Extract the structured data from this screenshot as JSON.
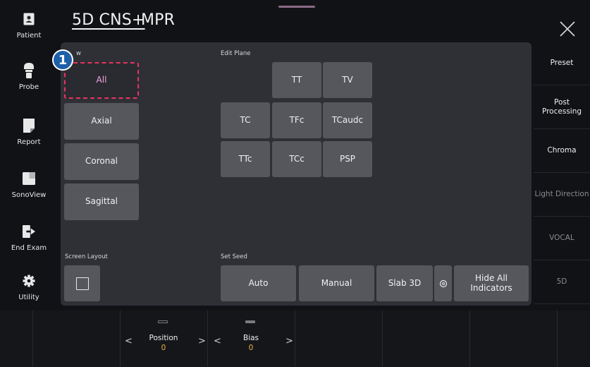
{
  "header": {
    "tabs": [
      {
        "label": "5D CNS+"
      },
      {
        "label": "MPR"
      }
    ]
  },
  "left_nav": [
    {
      "label": "Patient",
      "icon": "patient-icon"
    },
    {
      "label": "Probe",
      "icon": "probe-icon"
    },
    {
      "label": "Report",
      "icon": "report-icon"
    },
    {
      "label": "SonoView",
      "icon": "sonoview-icon"
    },
    {
      "label": "End Exam",
      "icon": "end-exam-icon"
    },
    {
      "label": "Utility",
      "icon": "gear-icon"
    }
  ],
  "panel": {
    "view_label": "w",
    "view_buttons": [
      "All",
      "Axial",
      "Coronal",
      "Sagittal"
    ],
    "edit_plane_label": "Edit Plane",
    "edit_plane_buttons": [
      "TT",
      "TV",
      "TC",
      "TFc",
      "TCaudc",
      "TTc",
      "TCc",
      "PSP"
    ],
    "screen_layout_label": "Screen Layout",
    "set_seed_label": "Set Seed",
    "seed_buttons": [
      "Auto",
      "Manual",
      "Slab 3D",
      "Hide All Indicators"
    ]
  },
  "badge": "1",
  "right_nav": [
    {
      "label": "Preset",
      "enabled": true
    },
    {
      "label": "Post Processing",
      "enabled": true
    },
    {
      "label": "Chroma",
      "enabled": true
    },
    {
      "label": "Light Direction",
      "enabled": false
    },
    {
      "label": "VOCAL",
      "enabled": false
    },
    {
      "label": "5D",
      "enabled": false
    }
  ],
  "bottom": {
    "knobs": [
      {
        "name": "Position",
        "value": "0"
      },
      {
        "name": "Bias",
        "value": "0"
      }
    ]
  },
  "colors": {
    "background": "#111216",
    "panel": "#2e3036",
    "button": "#55575d",
    "highlight_border": "#e8335e",
    "highlight_text": "#f2a7e6",
    "value_text": "#e3b24a",
    "badge": "#1d5fa8"
  }
}
